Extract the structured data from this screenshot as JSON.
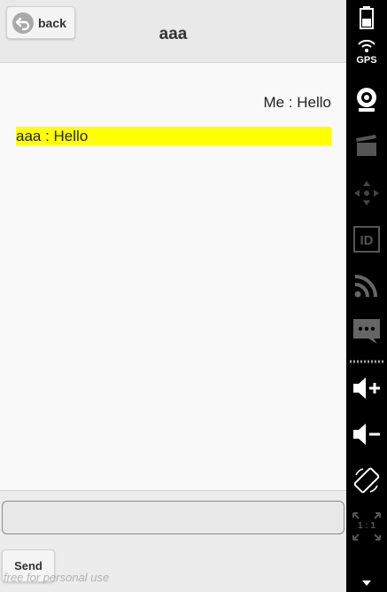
{
  "header": {
    "back_label": "back",
    "title": "aaa"
  },
  "messages": [
    {
      "text": "Me : Hello",
      "align": "right",
      "highlight": ""
    },
    {
      "text": "aaa : Hello",
      "align": "left",
      "highlight": "#ffff00"
    }
  ],
  "footer": {
    "input_value": "",
    "send_label": "Send"
  },
  "watermark": "free for personal use",
  "sidebar": {
    "gps_label": "GPS",
    "zoom_label": "1 : 1",
    "items": [
      "battery-icon",
      "gps-icon",
      "camera-icon",
      "video-icon",
      "dpad-icon",
      "id-icon",
      "rss-icon",
      "sms-icon",
      "volume-up-icon",
      "volume-down-icon",
      "rotate-icon",
      "scale-icon",
      "menu-caret-icon"
    ]
  },
  "colors": {
    "highlight": "#ffff00",
    "header_bg": "#e9e9e9",
    "screen_bg": "#f9f9f9",
    "sidebar_bg": "#000000",
    "sidebar_icon": "#b4b4b4"
  }
}
